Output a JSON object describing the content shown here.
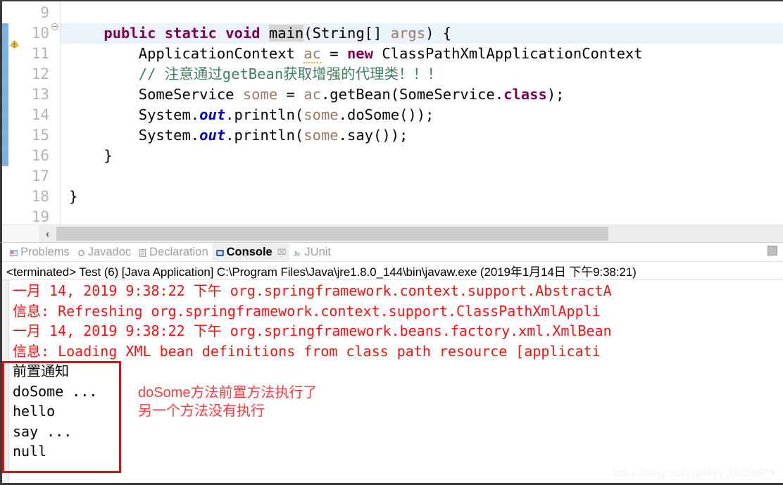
{
  "editor": {
    "lines": [
      {
        "num": "9",
        "highlight": false,
        "fold": false,
        "warn": false,
        "tokens": [
          {
            "t": "",
            "c": "plain"
          }
        ]
      },
      {
        "num": "10",
        "highlight": true,
        "fold": true,
        "warn": false,
        "tokens": [
          {
            "t": "    ",
            "c": "plain"
          },
          {
            "t": "public",
            "c": "kw"
          },
          {
            "t": " ",
            "c": "plain"
          },
          {
            "t": "static",
            "c": "kw"
          },
          {
            "t": " ",
            "c": "plain"
          },
          {
            "t": "void",
            "c": "kw"
          },
          {
            "t": " ",
            "c": "plain"
          },
          {
            "t": "main",
            "c": "occ"
          },
          {
            "t": "(String[] ",
            "c": "plain"
          },
          {
            "t": "args",
            "c": "lvar"
          },
          {
            "t": ") {",
            "c": "plain"
          }
        ]
      },
      {
        "num": "11",
        "highlight": false,
        "fold": false,
        "warn": true,
        "tokens": [
          {
            "t": "        ApplicationContext ",
            "c": "plain"
          },
          {
            "t": "ac",
            "c": "lvar squig"
          },
          {
            "t": " = ",
            "c": "plain"
          },
          {
            "t": "new",
            "c": "kw"
          },
          {
            "t": " ClassPathXmlApplicationContext",
            "c": "plain"
          }
        ]
      },
      {
        "num": "12",
        "highlight": false,
        "fold": false,
        "warn": false,
        "tokens": [
          {
            "t": "        // 注意通过getBean获取增强的代理类！！！",
            "c": "cmt"
          }
        ]
      },
      {
        "num": "13",
        "highlight": false,
        "fold": false,
        "warn": false,
        "tokens": [
          {
            "t": "        SomeService ",
            "c": "plain"
          },
          {
            "t": "some",
            "c": "lvar"
          },
          {
            "t": " = ",
            "c": "plain"
          },
          {
            "t": "ac",
            "c": "lvar"
          },
          {
            "t": ".getBean(SomeService.",
            "c": "plain"
          },
          {
            "t": "class",
            "c": "kw"
          },
          {
            "t": ");",
            "c": "plain"
          }
        ]
      },
      {
        "num": "14",
        "highlight": false,
        "fold": false,
        "warn": false,
        "tokens": [
          {
            "t": "        System.",
            "c": "plain"
          },
          {
            "t": "out",
            "c": "sfield"
          },
          {
            "t": ".println(",
            "c": "plain"
          },
          {
            "t": "some",
            "c": "lvar"
          },
          {
            "t": ".doSome());",
            "c": "plain"
          }
        ]
      },
      {
        "num": "15",
        "highlight": false,
        "fold": false,
        "warn": false,
        "tokens": [
          {
            "t": "        System.",
            "c": "plain"
          },
          {
            "t": "out",
            "c": "sfield"
          },
          {
            "t": ".println(",
            "c": "plain"
          },
          {
            "t": "some",
            "c": "lvar"
          },
          {
            "t": ".say());",
            "c": "plain"
          }
        ]
      },
      {
        "num": "16",
        "highlight": false,
        "fold": false,
        "warn": false,
        "tokens": [
          {
            "t": "    }",
            "c": "plain"
          }
        ]
      },
      {
        "num": "17",
        "highlight": false,
        "fold": false,
        "warn": false,
        "tokens": [
          {
            "t": "",
            "c": "plain"
          }
        ]
      },
      {
        "num": "18",
        "highlight": false,
        "fold": false,
        "warn": false,
        "tokens": [
          {
            "t": "}",
            "c": "plain"
          }
        ]
      },
      {
        "num": "19",
        "highlight": false,
        "fold": false,
        "warn": false,
        "tokens": [
          {
            "t": "",
            "c": "plain"
          }
        ]
      }
    ],
    "hscroll": {
      "left_arrow_label": "‹"
    }
  },
  "console": {
    "tabs": [
      {
        "label": "Problems",
        "icon": "problems-icon",
        "active": false,
        "closable": false
      },
      {
        "label": "Javadoc",
        "icon": "javadoc-icon",
        "active": false,
        "closable": false
      },
      {
        "label": "Declaration",
        "icon": "declaration-icon",
        "active": false,
        "closable": false
      },
      {
        "label": "Console",
        "icon": "console-icon",
        "active": true,
        "closable": true
      },
      {
        "label": "JUnit",
        "icon": "junit-icon",
        "active": false,
        "closable": false
      }
    ],
    "close_glyph": "⌧",
    "terminated_line": "<terminated> Test (6) [Java Application] C:\\Program Files\\Java\\jre1.8.0_144\\bin\\javaw.exe (2019年1月14日 下午9:38:21)",
    "output": [
      {
        "text": "一月 14, 2019 9:38:22 下午 org.springframework.context.support.AbstractA",
        "color": "red"
      },
      {
        "text": "信息: Refreshing org.springframework.context.support.ClassPathXmlAppli",
        "color": "red"
      },
      {
        "text": "一月 14, 2019 9:38:22 下午 org.springframework.beans.factory.xml.XmlBean",
        "color": "red"
      },
      {
        "text": "信息: Loading XML bean definitions from class path resource [applicati",
        "color": "red"
      },
      {
        "text": "前置通知",
        "color": "black"
      },
      {
        "text": "doSome ...",
        "color": "black"
      },
      {
        "text": "hello",
        "color": "black"
      },
      {
        "text": "say ...",
        "color": "black"
      },
      {
        "text": "null",
        "color": "black"
      }
    ]
  },
  "annotation": {
    "line1": "doSome方法前置方法执行了",
    "line2": "另一个方法没有执行",
    "color": "#fb3b3b"
  },
  "watermark": {
    "text": "https://blog.csdn.net/qq_38526573"
  },
  "colors": {
    "keyword": "#7f0055",
    "comment": "#3f7f5f",
    "local_var": "#9a7a6a",
    "static_field": "#0000c0",
    "console_red": "#fd0f0f",
    "annotation_red": "#ff0000",
    "line_highlight": "#eaf2fb",
    "change_bar": "#6aa5e0"
  }
}
